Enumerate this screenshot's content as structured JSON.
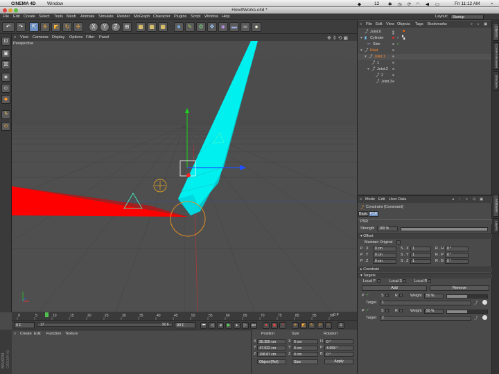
{
  "mac_menubar": {
    "app_name": "CINEMA 4D",
    "window_menu": "Window",
    "badge_count": "12",
    "clock": "Fri 11:12 AM"
  },
  "window": {
    "title": "HowItWorks.c4d *"
  },
  "menubar": {
    "items": [
      "File",
      "Edit",
      "Create",
      "Select",
      "Tools",
      "Mesh",
      "Animate",
      "Simulate",
      "Render",
      "MoGraph",
      "Character",
      "Plugins",
      "Script",
      "Window",
      "Help"
    ],
    "layout_label": "Layout:",
    "layout_value": "Startup"
  },
  "toolbar": {
    "axis_x": "X",
    "axis_y": "Y",
    "axis_z": "Z"
  },
  "viewport": {
    "menu": [
      "View",
      "Cameras",
      "Display",
      "Options",
      "Filter",
      "Panel"
    ],
    "label": "Perspective"
  },
  "timeline": {
    "ticks": [
      "0",
      "5",
      "10",
      "15",
      "20",
      "25",
      "30",
      "35",
      "40",
      "45",
      "50",
      "55",
      "60",
      "65",
      "70",
      "75",
      "80",
      "85",
      "90"
    ],
    "end_label": "0 F",
    "current_frame": "17"
  },
  "transport": {
    "start": "0 F",
    "current": "17",
    "end_field": "90 F",
    "end_field2": "90 F"
  },
  "material_manager": {
    "menu": [
      "Create",
      "Edit",
      "Function",
      "Texture"
    ],
    "vendor": "MAXON",
    "vendor_sub": "CINEMA 4D"
  },
  "coordinates": {
    "headers": [
      "Position",
      "Size",
      "Rotation"
    ],
    "rows": [
      {
        "axis": "X",
        "pos": "35.355 cm",
        "size_axis": "X",
        "size": "0 cm",
        "rot_axis": "H",
        "rot": "0 °"
      },
      {
        "axis": "Y",
        "pos": "47.922 cm",
        "size_axis": "Y",
        "size": "0 cm",
        "rot_axis": "P",
        "rot": "4.658 °"
      },
      {
        "axis": "Z",
        "pos": "198.87 cm",
        "size_axis": "Z",
        "size": "0 cm",
        "rot_axis": "B",
        "rot": "0 °"
      }
    ],
    "mode_select": "Object (Rel)",
    "size_select": "Size",
    "apply": "Apply"
  },
  "object_manager": {
    "menu": [
      "File",
      "Edit",
      "View",
      "Objects",
      "Tags",
      "Bookmarks"
    ],
    "objects": [
      {
        "name": "Joint.0",
        "indent": 1
      },
      {
        "name": "Cylinder",
        "indent": 1
      },
      {
        "name": "Skin",
        "indent": 2
      },
      {
        "name": "Root",
        "indent": 0
      },
      {
        "name": "Joint.1",
        "indent": 1
      },
      {
        "name": "1",
        "indent": 2
      },
      {
        "name": "Joint.2",
        "indent": 2
      },
      {
        "name": "2",
        "indent": 3
      },
      {
        "name": "Joint.3",
        "indent": 3
      }
    ],
    "highlight_colors": {
      "root": "#ff6a00",
      "joint1": "#ff6a00",
      "cylinder_tag": "#e82a2a"
    }
  },
  "side_tabs": [
    "Objects",
    "Content Browser",
    "Structure",
    "Attributes",
    "Layers"
  ],
  "attributes": {
    "menu": [
      "Mode",
      "Edit",
      "User Data"
    ],
    "object_title": "Constraint [Constraint]",
    "tabs": [
      "Basic",
      "PSR"
    ],
    "section_psr": "PSR",
    "strength_label": "Strength",
    "strength_value": "100 %",
    "strength_fraction": 1.0,
    "offset_section": "Offset",
    "maintain_original": "Maintain Original",
    "offset_rows": [
      {
        "p_axis": "P . X",
        "p_val": "0 cm",
        "s_axis": "S . X",
        "s_val": "1",
        "r_axis": "R . H",
        "r_val": "0 °"
      },
      {
        "p_axis": "P . Y",
        "p_val": "0 cm",
        "s_axis": "S . Y",
        "s_val": "1",
        "r_axis": "R . P",
        "r_val": "0 °"
      },
      {
        "p_axis": "P . Z",
        "p_val": "0 cm",
        "s_axis": "S . Z",
        "s_val": "1",
        "r_axis": "R . B",
        "r_val": "0 °"
      }
    ],
    "constrain_section": "Constrain",
    "targets_section": "Targets",
    "local_p": "Local P",
    "local_s": "Local S",
    "local_r": "Local R",
    "add": "Add",
    "remove": "Remove",
    "target_rows": [
      {
        "p": "P",
        "s": "S",
        "r": "R",
        "weight_label": "Weight",
        "weight": "50 %",
        "weight_fraction": 0.5,
        "target_label": "Target",
        "target": "1"
      },
      {
        "p": "P",
        "s": "S",
        "r": "R",
        "weight_label": "Weight",
        "weight": "50 %",
        "weight_fraction": 0.5,
        "target_label": "Target",
        "target": "2"
      }
    ]
  }
}
